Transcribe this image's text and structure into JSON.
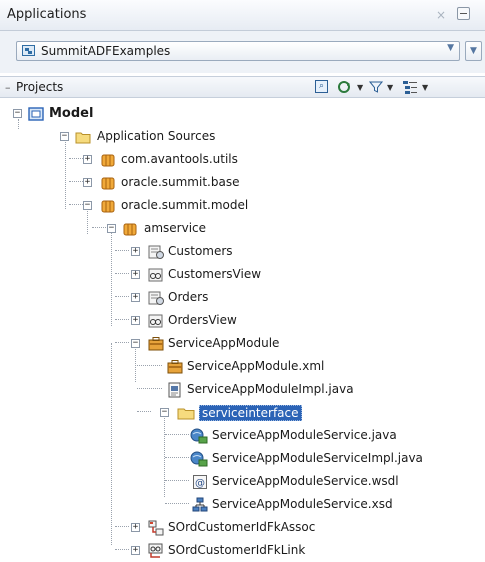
{
  "applications": {
    "title": "Applications",
    "close_glyph": "×",
    "selected_app": "SummitADFExamples",
    "dropdown_glyph": "▼"
  },
  "projects": {
    "title": "Projects",
    "toggle_glyph": "–",
    "toolbar": {
      "dropdown_glyph": "▼",
      "icons": [
        "find-icon",
        "sync-icon",
        "filter-icon",
        "options-icon"
      ]
    }
  },
  "tree": {
    "model": "Model",
    "application_sources": "Application Sources",
    "pkg_utils": "com.avantools.utils",
    "pkg_base": "oracle.summit.base",
    "pkg_model": "oracle.summit.model",
    "amservice": "amservice",
    "customers": "Customers",
    "customers_view": "CustomersView",
    "orders": "Orders",
    "orders_view": "OrdersView",
    "service_app_module": "ServiceAppModule",
    "service_app_module_xml": "ServiceAppModule.xml",
    "service_app_module_impl": "ServiceAppModuleImpl.java",
    "serviceinterface": "serviceinterface",
    "service_java": "ServiceAppModuleService.java",
    "service_impl_java": "ServiceAppModuleServiceImpl.java",
    "service_wsdl": "ServiceAppModuleService.wsdl",
    "service_xsd": "ServiceAppModuleService.xsd",
    "assoc": "SOrdCustomerIdFkAssoc",
    "link": "SOrdCustomerIdFkLink"
  },
  "glyphs": {
    "expand": "+",
    "collapse": "−"
  },
  "colors": {
    "selection": "#2b63b6",
    "accent": "#2c5f95"
  }
}
